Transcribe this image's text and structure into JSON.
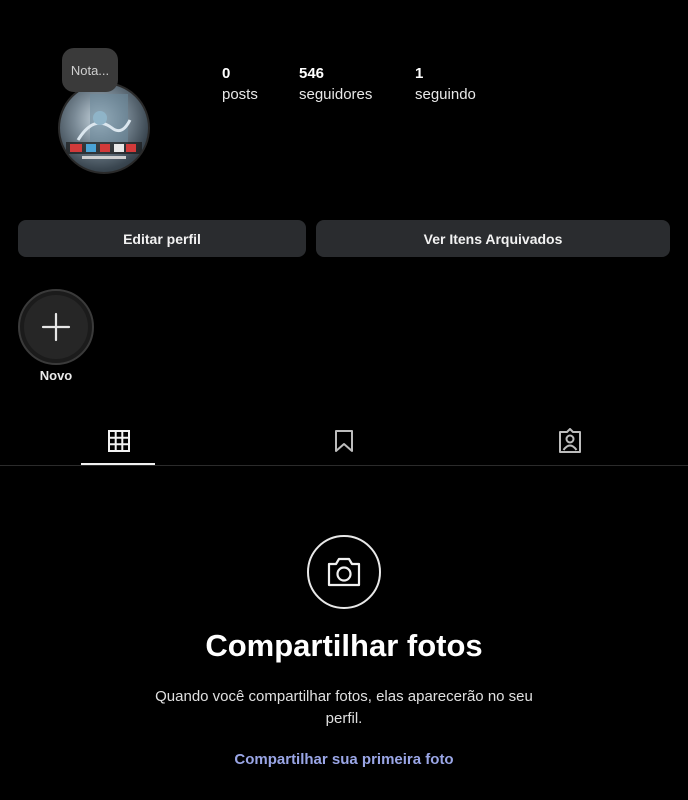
{
  "profile": {
    "note": "Nota...",
    "stats": [
      {
        "value": "0",
        "label": "posts"
      },
      {
        "value": "546",
        "label": "seguidores"
      },
      {
        "value": "1",
        "label": "seguindo"
      }
    ]
  },
  "actions": {
    "edit_profile": "Editar perfil",
    "archived_items": "Ver Itens Arquivados"
  },
  "highlights": {
    "new_label": "Novo",
    "new_icon": "plus-icon"
  },
  "tabs": [
    {
      "icon": "grid-icon",
      "selected": true
    },
    {
      "icon": "bookmark-icon",
      "selected": false
    },
    {
      "icon": "tagged-person-icon",
      "selected": false
    }
  ],
  "empty_state": {
    "icon": "camera-icon",
    "title": "Compartilhar fotos",
    "text": "Quando você compartilhar fotos, elas aparecerão no seu perfil.",
    "link": "Compartilhar sua primeira foto"
  },
  "colors": {
    "background": "#000000",
    "button": "#2a2c2f",
    "link": "#9aa6e6"
  }
}
